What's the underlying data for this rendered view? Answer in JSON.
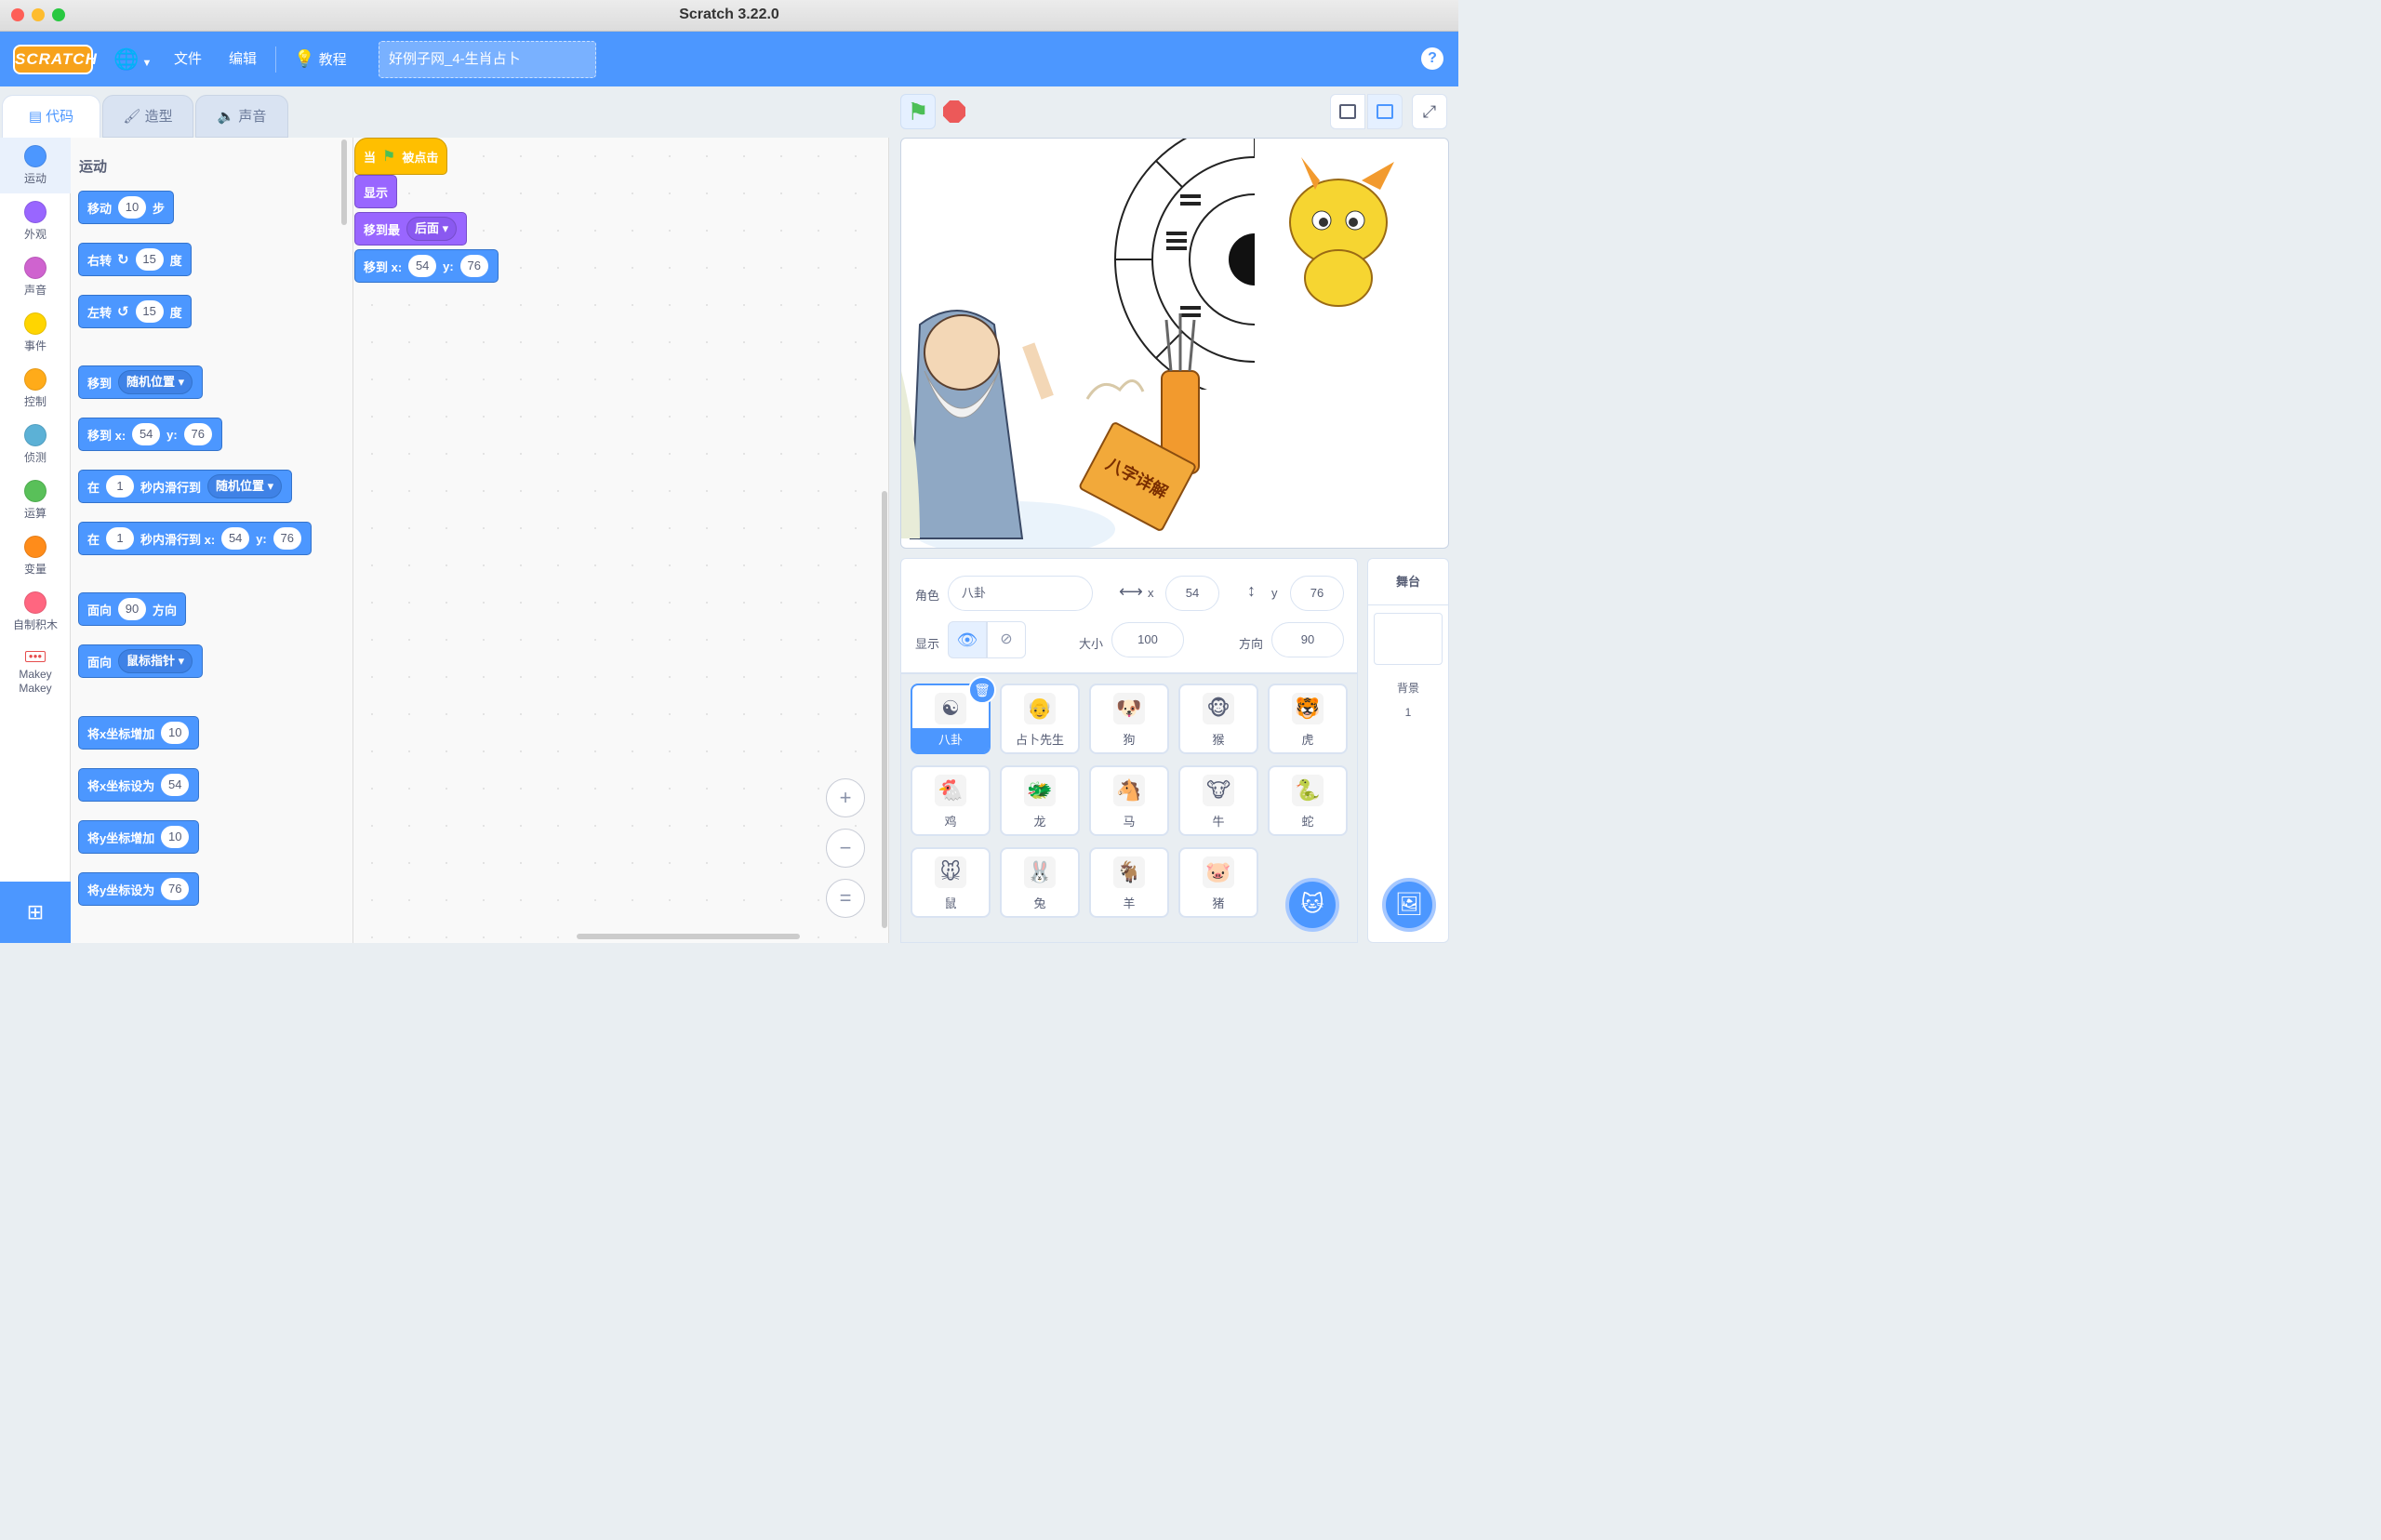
{
  "window": {
    "title": "Scratch 3.22.0"
  },
  "menubar": {
    "logo": "SCRATCH",
    "file": "文件",
    "edit": "编辑",
    "tutorial": "教程",
    "project_title": "好例子网_4-生肖占卜",
    "help": "?"
  },
  "tabs": {
    "code": "代码",
    "costumes": "造型",
    "sounds": "声音"
  },
  "categories": [
    {
      "label": "运动",
      "color": "#4c97ff"
    },
    {
      "label": "外观",
      "color": "#9966ff"
    },
    {
      "label": "声音",
      "color": "#cf63cf"
    },
    {
      "label": "事件",
      "color": "#ffd500"
    },
    {
      "label": "控制",
      "color": "#ffab19"
    },
    {
      "label": "侦测",
      "color": "#5cb1d6"
    },
    {
      "label": "运算",
      "color": "#59c059"
    },
    {
      "label": "变量",
      "color": "#ff8c1a"
    },
    {
      "label": "自制积木",
      "color": "#ff6680"
    },
    {
      "label": "Makey Makey",
      "color": "#e64d4d"
    }
  ],
  "palette": {
    "section": "运动",
    "move": {
      "a": "移动",
      "n": "10",
      "b": "步"
    },
    "turn_right": {
      "a": "右转",
      "n": "15",
      "b": "度"
    },
    "turn_left": {
      "a": "左转",
      "n": "15",
      "b": "度"
    },
    "goto": {
      "a": "移到",
      "dd": "随机位置"
    },
    "goto_xy": {
      "a": "移到 x:",
      "x": "54",
      "ylab": "y:",
      "y": "76"
    },
    "glide": {
      "a": "在",
      "n": "1",
      "b": "秒内滑行到",
      "dd": "随机位置"
    },
    "glide_xy": {
      "a": "在",
      "n": "1",
      "b": "秒内滑行到 x:",
      "x": "54",
      "ylab": "y:",
      "y": "76"
    },
    "point_dir": {
      "a": "面向",
      "n": "90",
      "b": "方向"
    },
    "point_towards": {
      "a": "面向",
      "dd": "鼠标指针"
    },
    "change_x": {
      "a": "将x坐标增加",
      "n": "10"
    },
    "set_x": {
      "a": "将x坐标设为",
      "n": "54"
    },
    "change_y": {
      "a": "将y坐标增加",
      "n": "10"
    },
    "set_y": {
      "a": "将y坐标设为",
      "n": "76"
    }
  },
  "script": {
    "hat": {
      "a": "当",
      "b": "被点击"
    },
    "show": "显示",
    "layer": {
      "a": "移到最",
      "dd": "后面"
    },
    "goto": {
      "a": "移到 x:",
      "x": "54",
      "ylab": "y:",
      "y": "76"
    }
  },
  "zoom": {
    "in": "+",
    "out": "−",
    "reset": "="
  },
  "sprite_info": {
    "sprite_label": "角色",
    "sprite_name": "八卦",
    "x_label": "x",
    "x": "54",
    "y_label": "y",
    "y": "76",
    "show_label": "显示",
    "size_label": "大小",
    "size": "100",
    "dir_label": "方向",
    "direction": "90"
  },
  "sprites": [
    {
      "name": "八卦",
      "icon": "☯"
    },
    {
      "name": "占卜先生",
      "icon": "👴"
    },
    {
      "name": "狗",
      "icon": "🐶"
    },
    {
      "name": "猴",
      "icon": "🐵"
    },
    {
      "name": "虎",
      "icon": "🐯"
    },
    {
      "name": "鸡",
      "icon": "🐔"
    },
    {
      "name": "龙",
      "icon": "🐲"
    },
    {
      "name": "马",
      "icon": "🐴"
    },
    {
      "name": "牛",
      "icon": "🐮"
    },
    {
      "name": "蛇",
      "icon": "🐍"
    },
    {
      "name": "鼠",
      "icon": "🐭"
    },
    {
      "name": "兔",
      "icon": "🐰"
    },
    {
      "name": "羊",
      "icon": "🐐"
    },
    {
      "name": "猪",
      "icon": "🐷"
    }
  ],
  "stage_panel": {
    "title": "舞台",
    "backdrop_label": "背景",
    "backdrop_count": "1"
  },
  "stage_art": {
    "book_text": "八字详解"
  },
  "colors": {
    "accent": "#4c97ff",
    "motion": "#4c97ff",
    "looks": "#9966ff",
    "events": "#ffbf00",
    "stop": "#ec5959",
    "flag": "#4cbf56"
  }
}
